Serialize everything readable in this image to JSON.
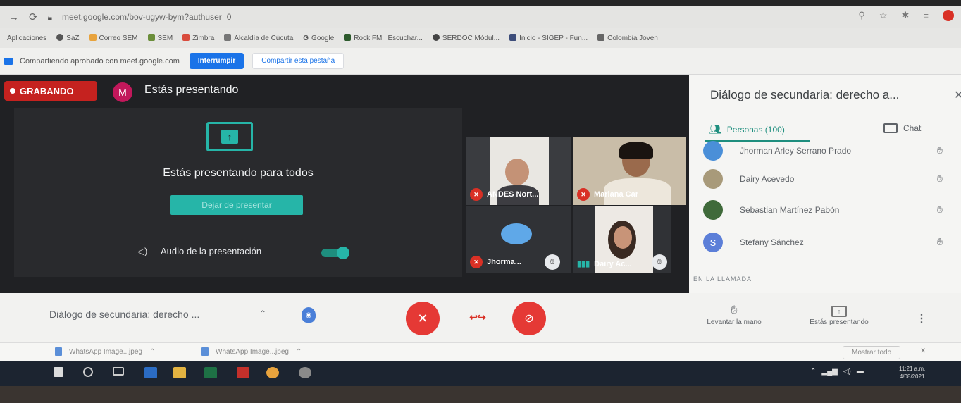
{
  "browser": {
    "url": "meet.google.com/bov-ugyw-bym?authuser=0",
    "bookmarks": [
      "Aplicaciones",
      "SaZ",
      "Correo SEM",
      "SEM",
      "Zimbra",
      "Alcaldía de Cúcuta",
      "Google",
      "Rock FM | Escuchar...",
      "SERDOC Módul...",
      "Inicio - SIGEP - Fun...",
      "Colombia Joven"
    ]
  },
  "sharebar": {
    "message": "Compartiendo aprobado con meet.google.com",
    "stop_label": "Interrumpir",
    "share_tab_label": "Compartir esta pestaña"
  },
  "meet": {
    "recording_label": "GRABANDO",
    "presenter_initial": "M",
    "presenting_title": "Estás presentando",
    "presenting_for_all": "Estás presentando para todos",
    "stop_presenting_label": "Dejar de presentar",
    "audio_label": "Audio de la presentación",
    "tiles": [
      {
        "name": "ANDES Nort...",
        "muted": true
      },
      {
        "name": "Mariana Car",
        "muted": true
      },
      {
        "name": "Jhorma...",
        "muted": true,
        "hand": true
      },
      {
        "name": "Dairy Ac...",
        "muted": false,
        "hand": true
      }
    ]
  },
  "panel": {
    "title": "Diálogo de secundaria: derecho a...",
    "people_tab": "Personas (100)",
    "chat_tab": "Chat",
    "participants": [
      {
        "name": "Jhorman Arley Serrano Prado",
        "avatar_color": "#4a8fd8",
        "initial": ""
      },
      {
        "name": "Dairy Acevedo",
        "avatar_color": "#a89a7a",
        "initial": ""
      },
      {
        "name": "Sebastian Martínez Pabón",
        "avatar_color": "#3f6a3a",
        "initial": ""
      },
      {
        "name": "Stefany Sánchez",
        "avatar_color": "#5c7fd8",
        "initial": "S"
      }
    ],
    "in_call_label": "EN LA LLAMADA"
  },
  "bottom": {
    "meeting_title": "Diálogo de secundaria: derecho ...",
    "raise_hand_label": "Levantar la mano",
    "presenting_label": "Estás presentando"
  },
  "downloads": {
    "file1": "WhatsApp Image...jpeg",
    "file2": "WhatsApp Image...jpeg",
    "show_all": "Mostrar todo"
  },
  "taskbar": {
    "clock_time": "11:21 a.m.",
    "clock_date": "4/08/2021"
  },
  "colors": {
    "accent": "#26b5a8",
    "recording": "#c5221f",
    "mic_off": "#e53935"
  }
}
